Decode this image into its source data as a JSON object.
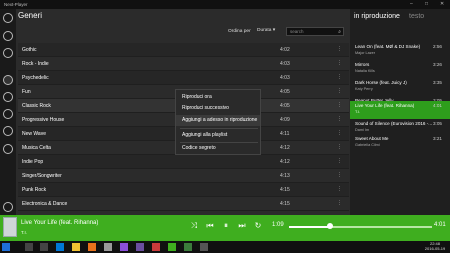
{
  "app": {
    "title": "Next-Player"
  },
  "header": {
    "title": "Generi"
  },
  "sort": {
    "label": "Ordina per",
    "selected": "Durata"
  },
  "search": {
    "placeholder": "search"
  },
  "rows": [
    {
      "name": "Gothic",
      "dur": "4:02"
    },
    {
      "name": "Rock - Indie",
      "dur": "4:03"
    },
    {
      "name": "Psychedelic",
      "dur": "4:03"
    },
    {
      "name": "Fun",
      "dur": "4:05"
    },
    {
      "name": "Classic Rock",
      "dur": "4:05"
    },
    {
      "name": "Progressive House",
      "dur": "4:09"
    },
    {
      "name": "New Wave",
      "dur": "4:11"
    },
    {
      "name": "Musica Celta",
      "dur": "4:12"
    },
    {
      "name": "Indie Pop",
      "dur": "4:12"
    },
    {
      "name": "Singer/Songwriter",
      "dur": "4:13"
    },
    {
      "name": "Punk Rock",
      "dur": "4:15"
    },
    {
      "name": "Electronica & Dance",
      "dur": "4:15"
    }
  ],
  "context_menu": {
    "items": [
      "Riproduci ora",
      "Riproduci successivo",
      "Aggiungi a adesso in riproduzione",
      "Aggiungi alla playlist",
      "Codice segreto"
    ]
  },
  "right_panel": {
    "tab_active": "in riproduzione",
    "tab_inactive": "testo",
    "queue": [
      {
        "title": "Lean On (feat. MØ & DJ Snake)",
        "artist": "Major Lazer",
        "dur": "2:56"
      },
      {
        "title": "Mirrors",
        "artist": "Natalia Kills",
        "dur": "3:26"
      },
      {
        "title": "Dark Horse (feat. Juicy J)",
        "artist": "Katy Perry",
        "dur": "3:35"
      },
      {
        "title": "Peanut Butter Jelly",
        "artist": "Galantis",
        "dur": "3:05"
      },
      {
        "title": "Live Your Life (feat. Rihanna)",
        "artist": "T.I.",
        "dur": "4:01"
      },
      {
        "title": "Sound of Silence (Eurovision 2016 -...",
        "artist": "Dami Im",
        "dur": "3:05"
      },
      {
        "title": "Sweet About Me",
        "artist": "Gabriella Cilmi",
        "dur": "3:21"
      }
    ]
  },
  "player": {
    "title": "Live Your Life (feat. Rihanna)",
    "artist": "T.I.",
    "elapsed": "1:09",
    "total": "4:01",
    "progress": 0.29
  },
  "clock": {
    "time": "22:48",
    "date": "2016-05-19"
  },
  "colors": {
    "accent": "#3fae1f"
  }
}
